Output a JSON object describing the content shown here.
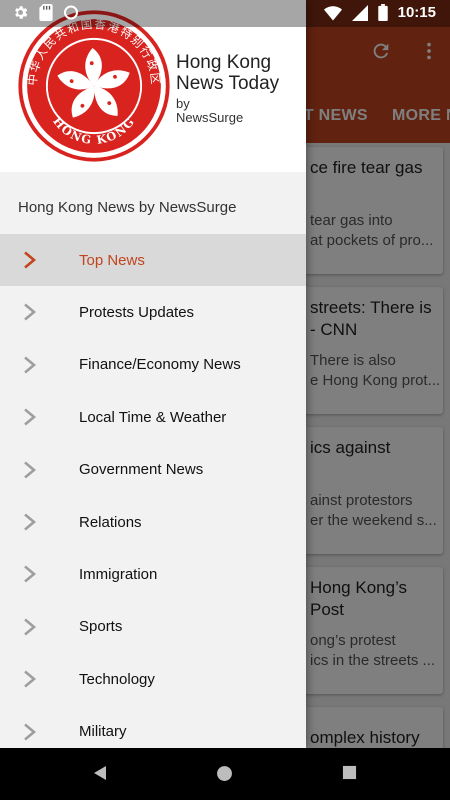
{
  "status_bar": {
    "time": "10:15"
  },
  "app": {
    "tabs": [
      "RT NEWS",
      "MORE N"
    ],
    "cards": [
      {
        "title": "ce fire tear gas",
        "body": [
          "tear gas into",
          "at pockets of pro..."
        ]
      },
      {
        "title": [
          "streets: There is",
          "- CNN"
        ],
        "body": [
          "There is also",
          "e Hong Kong prot..."
        ]
      },
      {
        "title": "ics against",
        "body": [
          "ainst protestors",
          "er the weekend s..."
        ]
      },
      {
        "title": [
          "Hong Kong’s",
          "Post"
        ],
        "body": [
          "ong’s protest",
          "ics in the streets ..."
        ]
      },
      {
        "title": "omplex history",
        "body": []
      }
    ]
  },
  "drawer": {
    "logo_text": "HONG KONG",
    "brand": {
      "line1": "Hong Kong",
      "line2": "News Today",
      "by": "by",
      "sub": "NewsSurge"
    },
    "subtitle": "Hong Kong News by NewsSurge",
    "items": [
      {
        "label": "Top News",
        "active": true
      },
      {
        "label": "Protests Updates",
        "active": false
      },
      {
        "label": "Finance/Economy News",
        "active": false
      },
      {
        "label": "Local Time & Weather",
        "active": false
      },
      {
        "label": "Government News",
        "active": false
      },
      {
        "label": "Relations",
        "active": false
      },
      {
        "label": "Immigration",
        "active": false
      },
      {
        "label": "Sports",
        "active": false
      },
      {
        "label": "Technology",
        "active": false
      },
      {
        "label": "Military",
        "active": false
      }
    ]
  },
  "colors": {
    "accent": "#c2451f",
    "logo_red": "#d8231f",
    "chevron": "#9e9e9e"
  }
}
